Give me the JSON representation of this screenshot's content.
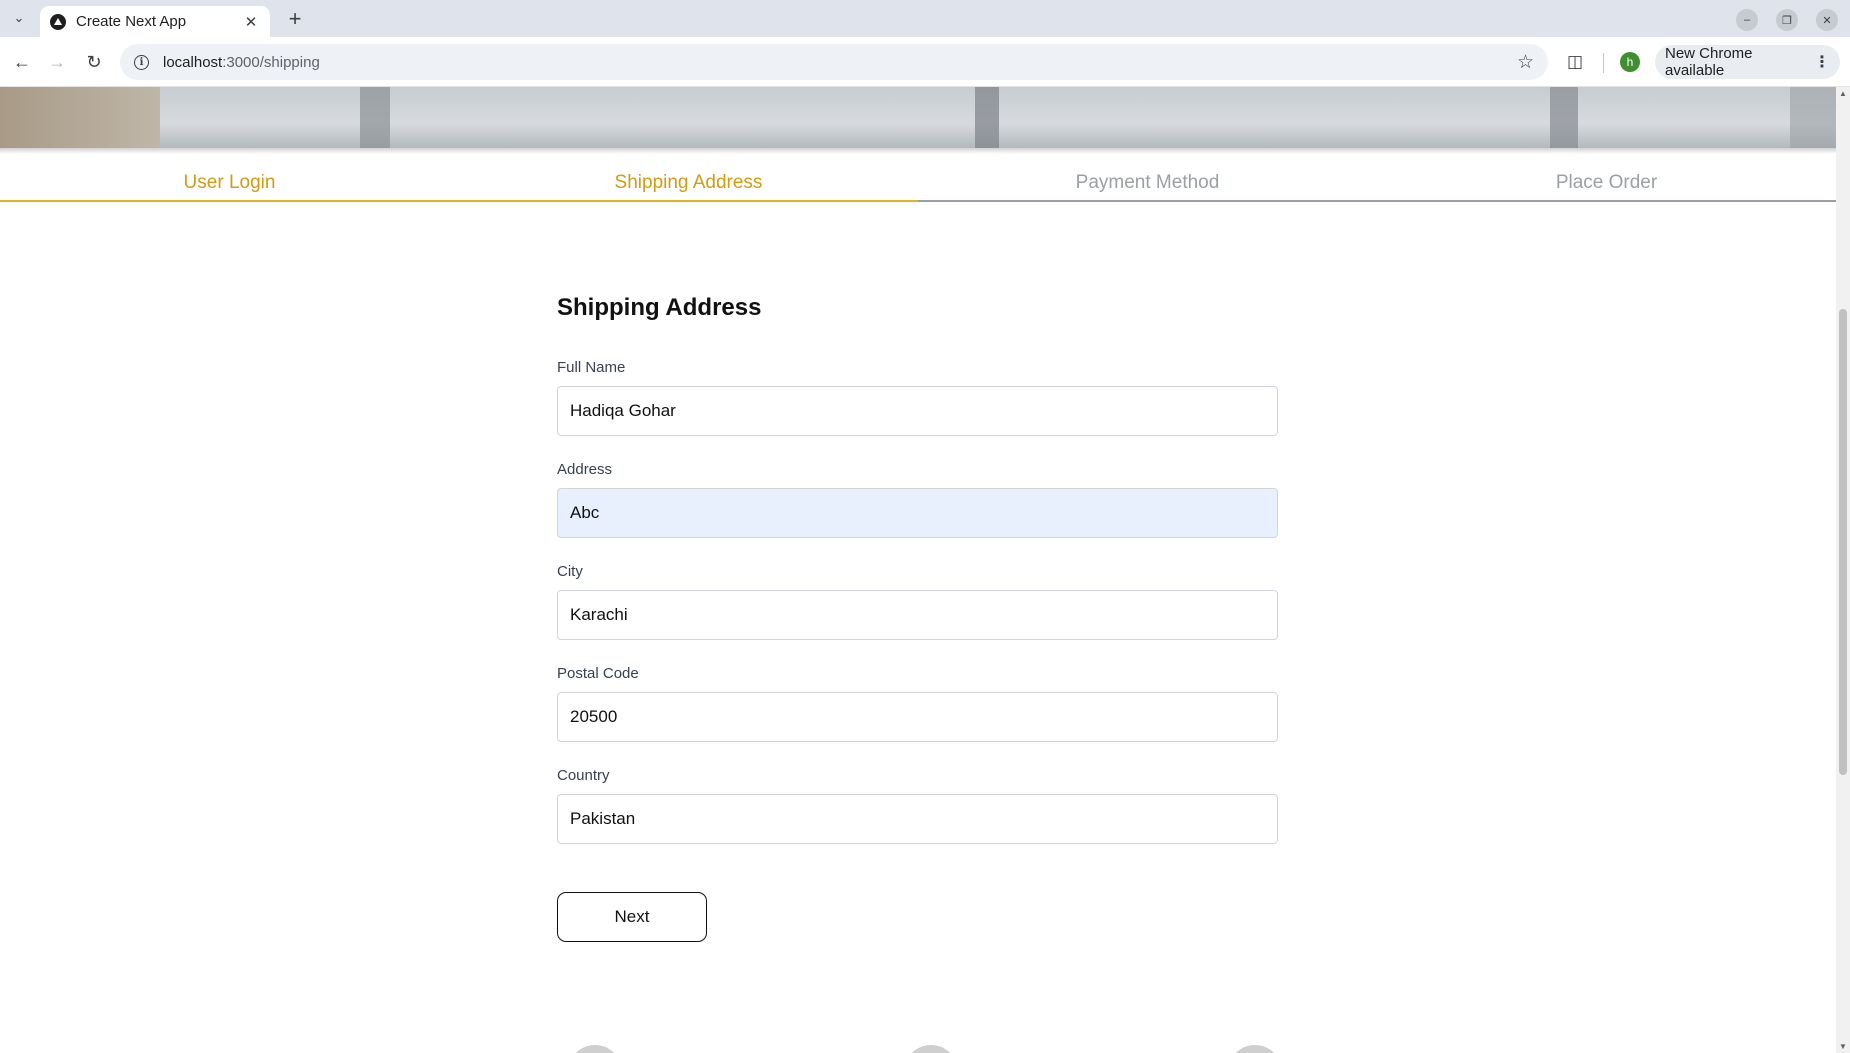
{
  "browser": {
    "tab_title": "Create Next App",
    "url_host": "localhost",
    "url_path": ":3000/shipping",
    "update_label": "New Chrome available",
    "profile_initial": "h"
  },
  "steps": [
    {
      "label": "User Login",
      "active": true
    },
    {
      "label": "Shipping Address",
      "active": true
    },
    {
      "label": "Payment Method",
      "active": false
    },
    {
      "label": "Place Order",
      "active": false
    }
  ],
  "form": {
    "title": "Shipping Address",
    "fields": {
      "full_name": {
        "label": "Full Name",
        "value": "Hadiqa Gohar"
      },
      "address": {
        "label": "Address",
        "value": "Abc"
      },
      "city": {
        "label": "City",
        "value": "Karachi"
      },
      "postal_code": {
        "label": "Postal Code",
        "value": "20500"
      },
      "country": {
        "label": "Country",
        "value": "Pakistan"
      }
    },
    "next_label": "Next"
  },
  "colors": {
    "accent": "#d29c10",
    "step_inactive": "#9aa0a6",
    "autofill": "#e8f0fe"
  }
}
